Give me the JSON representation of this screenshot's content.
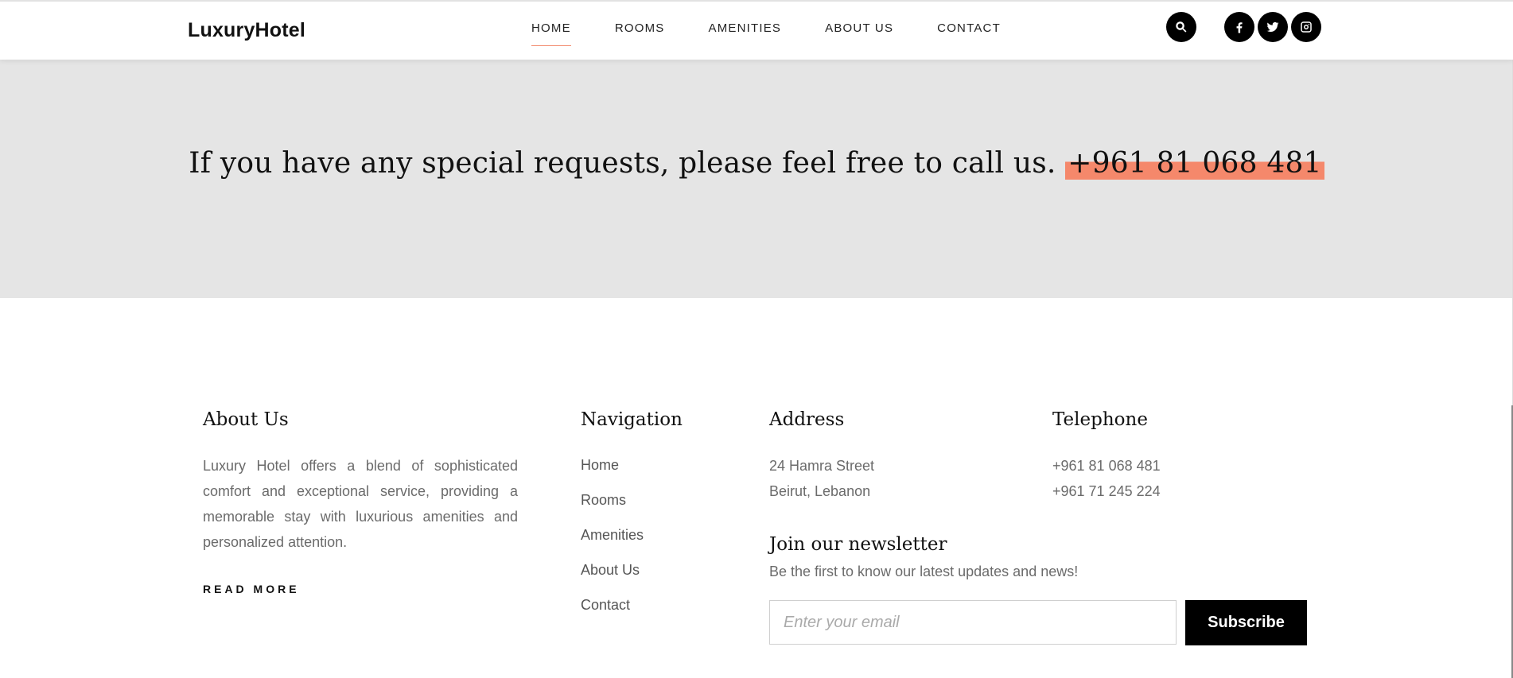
{
  "header": {
    "logo": "LuxuryHotel",
    "nav": [
      {
        "label": "HOME",
        "active": true
      },
      {
        "label": "ROOMS"
      },
      {
        "label": "AMENITIES"
      },
      {
        "label": "ABOUT US"
      },
      {
        "label": "CONTACT"
      }
    ],
    "icons": [
      "search-icon",
      "facebook-icon",
      "twitter-icon",
      "instagram-icon"
    ]
  },
  "band": {
    "text": "If you have any special requests, please feel free to call us.",
    "phone": "+961 81 068 481",
    "highlight_color": "#f5886b"
  },
  "footer": {
    "about": {
      "title": "About Us",
      "text": "Luxury Hotel offers a blend of sophisticated comfort and exceptional service, providing a memorable stay with luxurious amenities and personalized attention.",
      "read_more": "READ MORE"
    },
    "navigation": {
      "title": "Navigation",
      "links": [
        "Home",
        "Rooms",
        "Amenities",
        "About Us",
        "Contact"
      ]
    },
    "address": {
      "title": "Address",
      "line1": "24 Hamra Street",
      "line2": "Beirut, Lebanon"
    },
    "telephone": {
      "title": "Telephone",
      "line1": "+961 81 068 481",
      "line2": "+961 71 245 224"
    },
    "newsletter": {
      "title": "Join our newsletter",
      "subtitle": "Be the first to know our latest updates and news!",
      "placeholder": "Enter your email",
      "button": "Subscribe"
    }
  }
}
